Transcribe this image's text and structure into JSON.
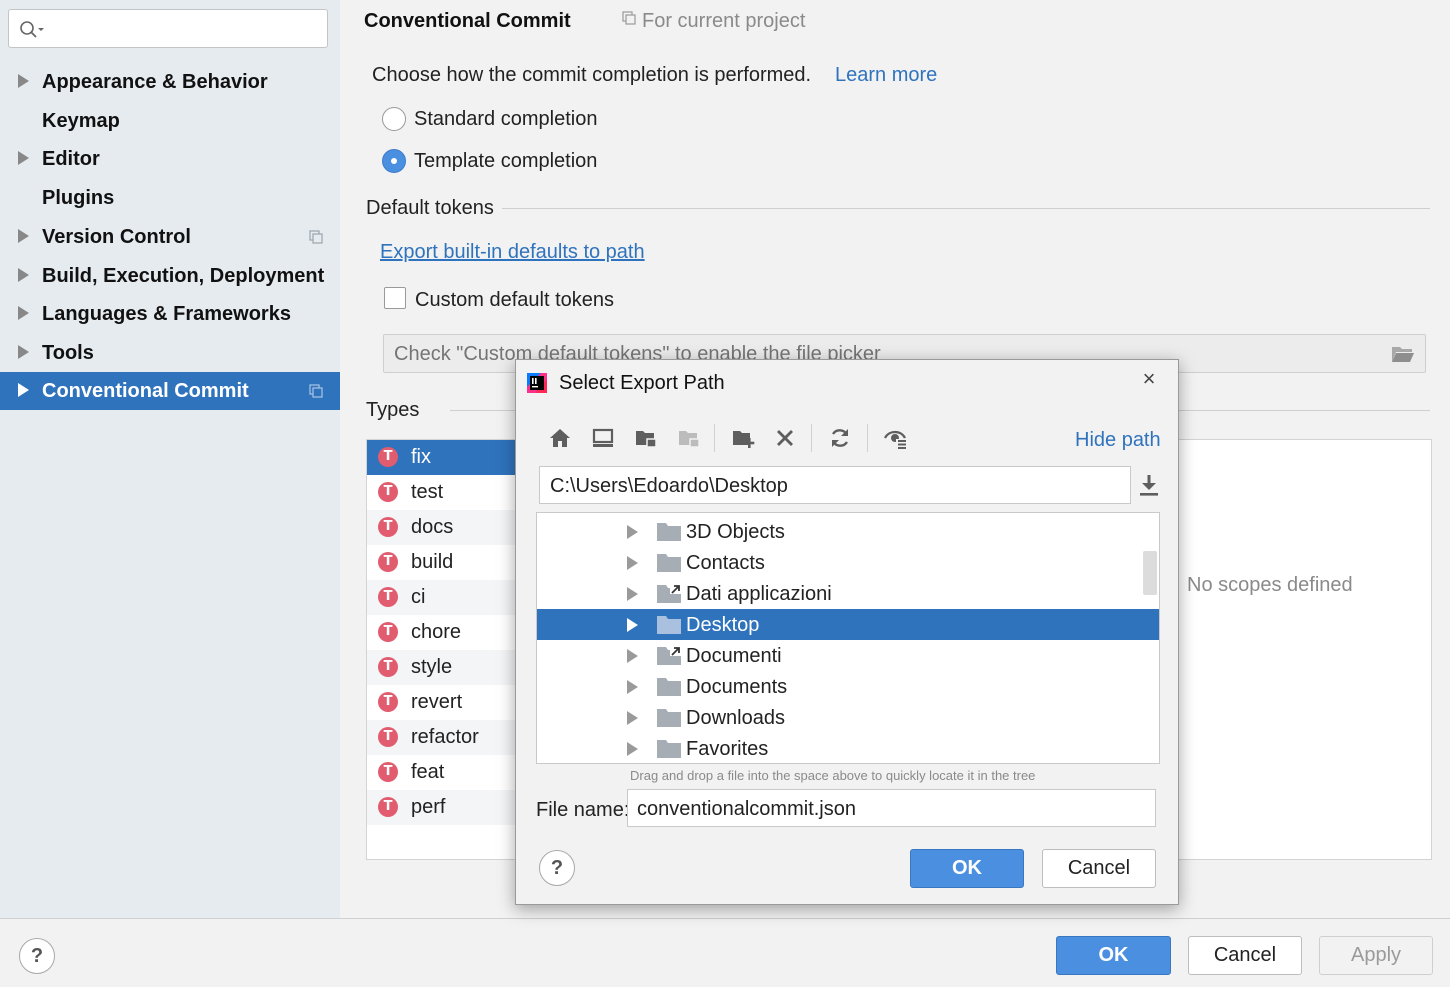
{
  "sidebar": {
    "search_placeholder": "",
    "items": [
      {
        "label": "Appearance & Behavior",
        "expandable": true,
        "project_scope": false
      },
      {
        "label": "Keymap",
        "expandable": false,
        "project_scope": false
      },
      {
        "label": "Editor",
        "expandable": true,
        "project_scope": false
      },
      {
        "label": "Plugins",
        "expandable": false,
        "project_scope": false
      },
      {
        "label": "Version Control",
        "expandable": true,
        "project_scope": true
      },
      {
        "label": "Build, Execution, Deployment",
        "expandable": true,
        "project_scope": false
      },
      {
        "label": "Languages & Frameworks",
        "expandable": true,
        "project_scope": false
      },
      {
        "label": "Tools",
        "expandable": true,
        "project_scope": false
      },
      {
        "label": "Conventional Commit",
        "expandable": true,
        "project_scope": true,
        "selected": true
      }
    ]
  },
  "main": {
    "title": "Conventional Commit",
    "scope": "For current project",
    "description": "Choose how the commit completion is performed.",
    "learn_more": "Learn more",
    "completion_options": [
      {
        "label": "Standard completion",
        "checked": false
      },
      {
        "label": "Template completion",
        "checked": true
      }
    ],
    "default_tokens_title": "Default tokens",
    "export_link": "Export built-in defaults to path",
    "custom_tokens_label": "Custom default tokens",
    "custom_tokens_checked": false,
    "file_picker_placeholder": "Check \"Custom default tokens\" to enable the file picker",
    "types_title": "Types",
    "types": [
      "fix",
      "test",
      "docs",
      "build",
      "ci",
      "chore",
      "style",
      "revert",
      "refactor",
      "feat",
      "perf"
    ],
    "selected_type": "fix",
    "type_icon_letter": "T",
    "empty_text": "No scopes defined"
  },
  "bottom": {
    "help": "?",
    "ok": "OK",
    "cancel": "Cancel",
    "apply": "Apply"
  },
  "dialog": {
    "title": "Select Export Path",
    "close": "×",
    "toolbar_icons": [
      "home-icon",
      "desktop-icon",
      "project-folder-icon",
      "module-folder-icon",
      "new-folder-icon",
      "delete-icon",
      "refresh-icon",
      "show-hidden-icon"
    ],
    "hide_path": "Hide path",
    "path": "C:\\Users\\Edoardo\\Desktop",
    "tree": [
      {
        "label": "3D Objects",
        "shortcut": false
      },
      {
        "label": "Contacts",
        "shortcut": false
      },
      {
        "label": "Dati applicazioni",
        "shortcut": true
      },
      {
        "label": "Desktop",
        "shortcut": false,
        "selected": true
      },
      {
        "label": "Documenti",
        "shortcut": true
      },
      {
        "label": "Documents",
        "shortcut": false
      },
      {
        "label": "Downloads",
        "shortcut": false
      },
      {
        "label": "Favorites",
        "shortcut": false
      }
    ],
    "drag_hint": "Drag and drop a file into the space above to quickly locate it in the tree",
    "file_name_label": "File name:",
    "file_name": "conventionalcommit.json",
    "help": "?",
    "ok": "OK",
    "cancel": "Cancel"
  },
  "colors": {
    "accent": "#2f73bd",
    "primary_button": "#4a8fe0",
    "type_icon": "#e05c6e",
    "sidebar_bg": "#e6ebf0"
  }
}
